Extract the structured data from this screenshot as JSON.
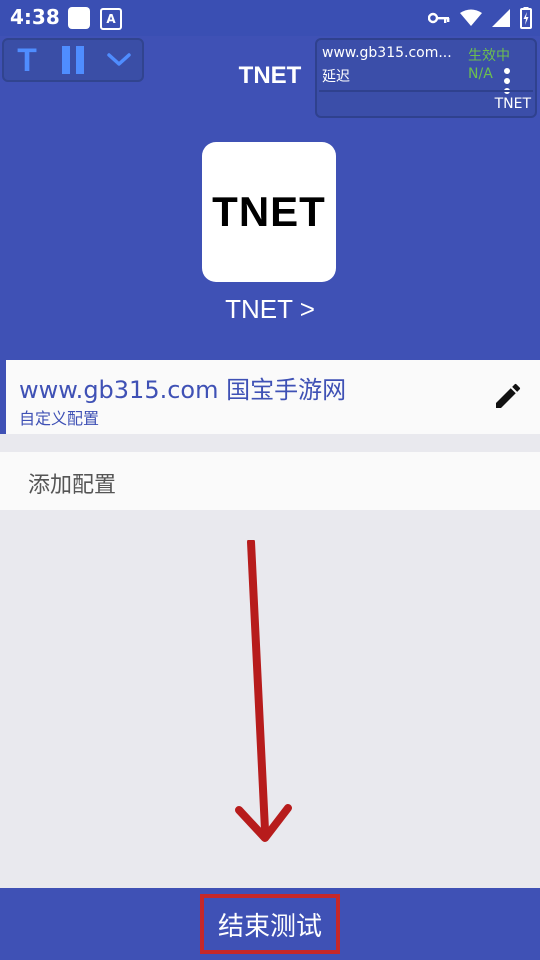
{
  "status_bar": {
    "time": "4:38",
    "a_badge": "A",
    "icons": [
      "notification-square-icon",
      "app-a-icon",
      "vpn-key-icon",
      "wifi-icon",
      "signal-icon",
      "battery-icon"
    ]
  },
  "header": {
    "title": "TNET",
    "toolbar": {
      "t_label": "T",
      "icons": [
        "t-icon",
        "pause-icon",
        "chevron-down-icon"
      ]
    },
    "stats": {
      "host": "www.gb315.com...",
      "status": "生效中",
      "delay_label": "延迟",
      "delay_value": "N/A",
      "app_name": "TNET"
    },
    "logo_text": "TNET",
    "logo_label": "TNET >"
  },
  "config": {
    "title": "www.gb315.com 国宝手游网",
    "subtitle": "自定义配置"
  },
  "add_config_label": "添加配置",
  "bottom": {
    "end_test_label": "结束测试"
  },
  "colors": {
    "primary": "#3f51b5",
    "status_bar": "#3a4fb3",
    "accent_blue": "#4f8dff",
    "status_green": "#6cbf4f",
    "arrow_red": "#b71c1c",
    "highlight_red": "#c62828",
    "background": "#e9e9ee"
  }
}
